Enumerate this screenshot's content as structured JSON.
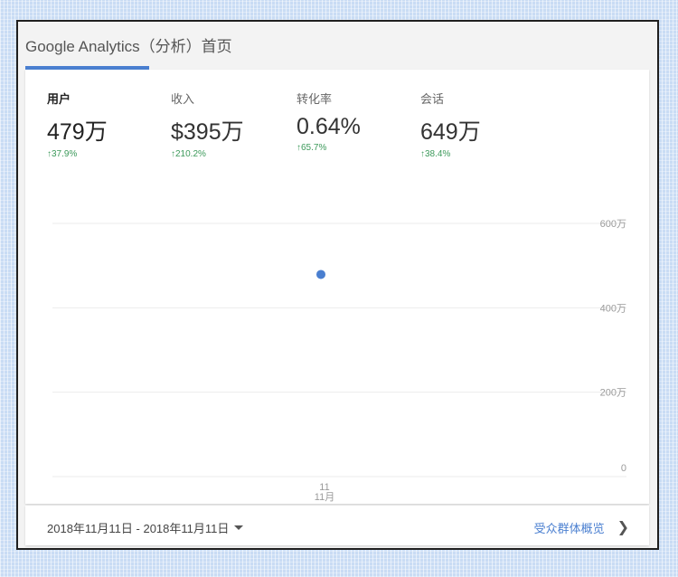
{
  "header": {
    "app_title": "Google Analytics（分析）首页"
  },
  "metrics": [
    {
      "label": "用户",
      "value": "479万",
      "change": "↑37.9%"
    },
    {
      "label": "收入",
      "value": "$395万",
      "change": "↑210.2%"
    },
    {
      "label": "转化率",
      "value": "0.64%",
      "change": "↑65.7%"
    },
    {
      "label": "会话",
      "value": "649万",
      "change": "↑38.4%"
    }
  ],
  "chart_data": {
    "type": "scatter",
    "x": [
      "11\n11月"
    ],
    "x_tick_lines": [
      "11",
      "11月"
    ],
    "series": [
      {
        "values": [
          4790000
        ]
      }
    ],
    "y_ticks": [
      "0",
      "200万",
      "400万",
      "600万"
    ],
    "ylim": [
      0,
      6000000
    ],
    "grid": true,
    "point_color": "#4a7fd0"
  },
  "footer": {
    "date_range": "2018年11月11日 - 2018年11月11日",
    "audience_link": "受众群体概览"
  },
  "colors": {
    "accent": "#4a7fd0",
    "positive": "#3d9a5b"
  }
}
